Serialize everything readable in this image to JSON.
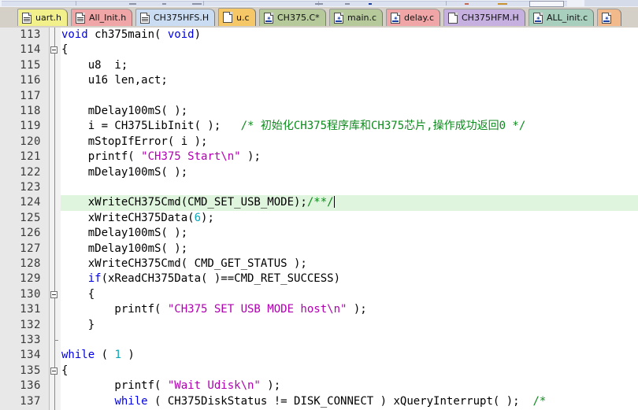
{
  "window": {
    "app": "code-editor",
    "toolbar_visible_sliver": true
  },
  "tabbar": {
    "tabs": [
      {
        "label": "uart.h",
        "color": "#f2f08a",
        "icon": "file-lines-icon",
        "active": false,
        "modified": false
      },
      {
        "label": "All_Init.h",
        "color": "#f0a6a6",
        "icon": "file-lines-icon",
        "active": false,
        "modified": false
      },
      {
        "label": "CH375HFS.H",
        "color": "#c9dcf2",
        "icon": "file-lines-icon",
        "active": false,
        "modified": false
      },
      {
        "label": "u.c",
        "color": "#f5c766",
        "icon": "file-blank-icon",
        "active": true,
        "modified": false
      },
      {
        "label": "CH375.C*",
        "color": "#b5c99a",
        "icon": "file-source-icon",
        "active": false,
        "modified": true
      },
      {
        "label": "main.c",
        "color": "#b5c99a",
        "icon": "file-source-icon",
        "active": false,
        "modified": false
      },
      {
        "label": "delay.c",
        "color": "#f0a6a6",
        "icon": "file-source-icon",
        "active": false,
        "modified": false
      },
      {
        "label": "CH375HFM.H",
        "color": "#c6b0e0",
        "icon": "file-blank-icon",
        "active": false,
        "modified": false
      },
      {
        "label": "ALL_init.c",
        "color": "#a8cfbe",
        "icon": "file-source-icon",
        "active": false,
        "modified": false
      },
      {
        "label": "",
        "color": "#f2b98a",
        "icon": "file-source-icon",
        "active": false,
        "modified": false
      }
    ]
  },
  "editor": {
    "language": "c",
    "first_visible_line": 113,
    "last_visible_line": 137,
    "current_line": 124,
    "caret_line": 124,
    "caret_column": 39,
    "colors": {
      "keyword": "#0000e6",
      "string": "#b000b0",
      "comment": "#0f8a1e",
      "number": "#0aa6b8",
      "text": "#000000",
      "current_line_bg": "#dff5dd",
      "gutter_bg": "#e8e8e8",
      "background": "#ffffff"
    },
    "lines": [
      {
        "n": 113,
        "fold": "none",
        "highlight": false,
        "text": "void ch375main( void)"
      },
      {
        "n": 114,
        "fold": "start",
        "highlight": false,
        "text": "{"
      },
      {
        "n": 115,
        "fold": "none",
        "highlight": false,
        "text": "    u8  i;"
      },
      {
        "n": 116,
        "fold": "none",
        "highlight": false,
        "text": "    u16 len,act;"
      },
      {
        "n": 117,
        "fold": "none",
        "highlight": false,
        "text": ""
      },
      {
        "n": 118,
        "fold": "none",
        "highlight": false,
        "text": "    mDelay100mS( );"
      },
      {
        "n": 119,
        "fold": "none",
        "highlight": false,
        "text": "    i = CH375LibInit( );   /* 初始化CH375程序库和CH375芯片,操作成功返回0 */"
      },
      {
        "n": 120,
        "fold": "none",
        "highlight": false,
        "text": "    mStopIfError( i );"
      },
      {
        "n": 121,
        "fold": "none",
        "highlight": false,
        "text": "    printf( \"CH375 Start\\n\" );"
      },
      {
        "n": 122,
        "fold": "none",
        "highlight": false,
        "text": "    mDelay100mS( );"
      },
      {
        "n": 123,
        "fold": "none",
        "highlight": false,
        "text": ""
      },
      {
        "n": 124,
        "fold": "none",
        "highlight": true,
        "text": "    xWriteCH375Cmd(CMD_SET_USB_MODE);/**/"
      },
      {
        "n": 125,
        "fold": "none",
        "highlight": false,
        "text": "    xWriteCH375Data(6);"
      },
      {
        "n": 126,
        "fold": "none",
        "highlight": false,
        "text": "    mDelay100mS( );"
      },
      {
        "n": 127,
        "fold": "none",
        "highlight": false,
        "text": "    mDelay100mS( );"
      },
      {
        "n": 128,
        "fold": "none",
        "highlight": false,
        "text": "    xWriteCH375Cmd( CMD_GET_STATUS );"
      },
      {
        "n": 129,
        "fold": "none",
        "highlight": false,
        "text": "    if(xReadCH375Data( )==CMD_RET_SUCCESS)"
      },
      {
        "n": 130,
        "fold": "start",
        "highlight": false,
        "text": "    {"
      },
      {
        "n": 131,
        "fold": "none",
        "highlight": false,
        "text": "        printf( \"CH375 SET USB MODE host\\n\" );"
      },
      {
        "n": 132,
        "fold": "none",
        "highlight": false,
        "text": "    }"
      },
      {
        "n": 133,
        "fold": "end",
        "highlight": false,
        "text": ""
      },
      {
        "n": 134,
        "fold": "none",
        "highlight": false,
        "text": "while ( 1 )"
      },
      {
        "n": 135,
        "fold": "start",
        "highlight": false,
        "text": "{"
      },
      {
        "n": 136,
        "fold": "none",
        "highlight": false,
        "text": "        printf( \"Wait Udisk\\n\" );"
      },
      {
        "n": 137,
        "fold": "none",
        "highlight": false,
        "text": "        while ( CH375DiskStatus != DISK_CONNECT ) xQueryInterrupt( );  /*"
      }
    ],
    "tokens": {
      "113": [
        {
          "t": "void",
          "c": "kw"
        },
        {
          "t": " ch375main( ",
          "c": ""
        },
        {
          "t": "void",
          "c": "kw"
        },
        {
          "t": ")",
          "c": ""
        }
      ],
      "114": [
        {
          "t": "{",
          "c": ""
        }
      ],
      "115": [
        {
          "t": "    u8  i;",
          "c": ""
        }
      ],
      "116": [
        {
          "t": "    u16 len,act;",
          "c": ""
        }
      ],
      "117": [
        {
          "t": "",
          "c": ""
        }
      ],
      "118": [
        {
          "t": "    mDelay100mS( );",
          "c": ""
        }
      ],
      "119": [
        {
          "t": "    i = CH375LibInit( );   ",
          "c": ""
        },
        {
          "t": "/* 初始化CH375程序库和CH375芯片,操作成功返回0 */",
          "c": "cmt"
        }
      ],
      "120": [
        {
          "t": "    mStopIfError( i );",
          "c": ""
        }
      ],
      "121": [
        {
          "t": "    printf( ",
          "c": ""
        },
        {
          "t": "\"CH375 Start\\n\"",
          "c": "str"
        },
        {
          "t": " );",
          "c": ""
        }
      ],
      "122": [
        {
          "t": "    mDelay100mS( );",
          "c": ""
        }
      ],
      "123": [
        {
          "t": "",
          "c": ""
        }
      ],
      "124": [
        {
          "t": "    xWriteCH375Cmd(CMD_SET_USB_MODE);",
          "c": ""
        },
        {
          "t": "/**/",
          "c": "cmt"
        },
        {
          "t": "|CARET|",
          "c": "caret"
        }
      ],
      "125": [
        {
          "t": "    xWriteCH375Data(",
          "c": ""
        },
        {
          "t": "6",
          "c": "num"
        },
        {
          "t": ");",
          "c": ""
        }
      ],
      "126": [
        {
          "t": "    mDelay100mS( );",
          "c": ""
        }
      ],
      "127": [
        {
          "t": "    mDelay100mS( );",
          "c": ""
        }
      ],
      "128": [
        {
          "t": "    xWriteCH375Cmd( CMD_GET_STATUS );",
          "c": ""
        }
      ],
      "129": [
        {
          "t": "    ",
          "c": ""
        },
        {
          "t": "if",
          "c": "kw"
        },
        {
          "t": "(xReadCH375Data( )==CMD_RET_SUCCESS)",
          "c": ""
        }
      ],
      "130": [
        {
          "t": "    {",
          "c": ""
        }
      ],
      "131": [
        {
          "t": "        printf( ",
          "c": ""
        },
        {
          "t": "\"CH375 SET USB MODE host\\n\"",
          "c": "str"
        },
        {
          "t": " );",
          "c": ""
        }
      ],
      "132": [
        {
          "t": "    }",
          "c": ""
        }
      ],
      "133": [
        {
          "t": "",
          "c": ""
        }
      ],
      "134": [
        {
          "t": "",
          "c": ""
        },
        {
          "t": "while",
          "c": "kw"
        },
        {
          "t": " ( ",
          "c": ""
        },
        {
          "t": "1",
          "c": "num"
        },
        {
          "t": " )",
          "c": ""
        }
      ],
      "135": [
        {
          "t": "{",
          "c": ""
        }
      ],
      "136": [
        {
          "t": "        printf( ",
          "c": ""
        },
        {
          "t": "\"Wait Udisk\\n\"",
          "c": "str"
        },
        {
          "t": " );",
          "c": ""
        }
      ],
      "137": [
        {
          "t": "        ",
          "c": ""
        },
        {
          "t": "while",
          "c": "kw"
        },
        {
          "t": " ( CH375DiskStatus != DISK_CONNECT ) xQueryInterrupt( );  ",
          "c": ""
        },
        {
          "t": "/*",
          "c": "cmt"
        }
      ]
    }
  }
}
